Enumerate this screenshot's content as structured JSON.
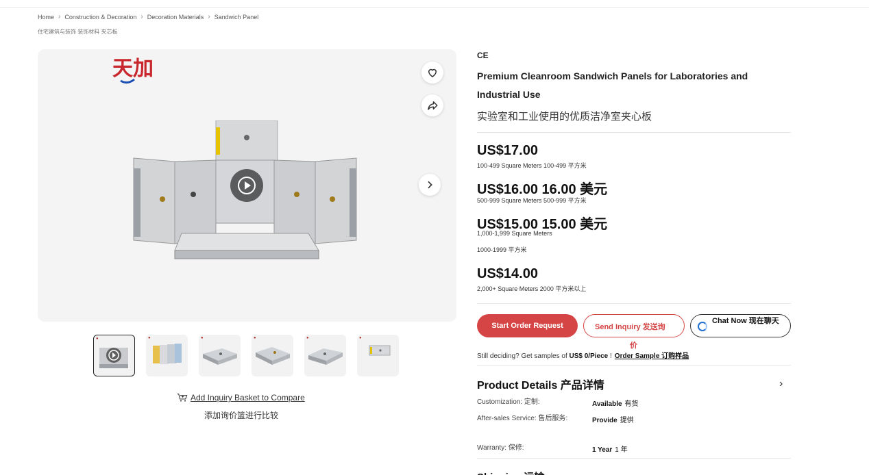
{
  "breadcrumb": {
    "items": [
      "Home",
      "Construction & Decoration",
      "Decoration Materials",
      "Sandwich Panel"
    ],
    "sub": "住宅建筑与装饰 装饰材料 夹芯板"
  },
  "gallery": {
    "logo_text": "天加",
    "thumbnail_count": 6
  },
  "compare": {
    "label": "Add Inquiry Basket to Compare",
    "label_cn": "添加询价篮进行比较"
  },
  "product": {
    "cert": "CE",
    "title": "Premium Cleanroom Sandwich Panels for Laboratories and Industrial Use",
    "title_cn": "实验室和工业使用的优质洁净室夹心板"
  },
  "prices": [
    {
      "price": "US$17.00",
      "range": "100-499 Square Meters  100-499 平方米"
    },
    {
      "price": "US$16.00  16.00 美元",
      "range": "500-999 Square Meters  500-999 平方米"
    },
    {
      "price": "US$15.00  15.00 美元",
      "range": "1,000-1,999 Square Meters",
      "range_cn": "1000-1999 平方米"
    },
    {
      "price": "US$14.00",
      "range": "2,000+ Square Meters  2000 平方米以上"
    }
  ],
  "actions": {
    "start_order": "Start Order Request",
    "send_inquiry": "Send Inquiry  发送询",
    "send_inquiry_wrap": "价",
    "chat_now": "Chat Now  现在聊天"
  },
  "sample": {
    "text": "Still deciding? Get samples of ",
    "price": "US$ 0/Piece",
    "bang": " !",
    "link": "Order Sample   订购样品"
  },
  "details": {
    "title": "Product Details  产品详情",
    "rows": [
      {
        "label": "Customization:  定制:",
        "value": "Available",
        "value_cn": "有货"
      },
      {
        "label": "After-sales Service:  售后服务:",
        "value": "Provide",
        "value_cn": "提供"
      },
      {
        "label": "Warranty:  保修:",
        "value": "1 Year",
        "value_cn": "1 年"
      }
    ]
  },
  "shipping": {
    "title": "Shipping  运输"
  },
  "colors": {
    "accent": "#d64545",
    "chat_ring": "#1f6fd1"
  }
}
